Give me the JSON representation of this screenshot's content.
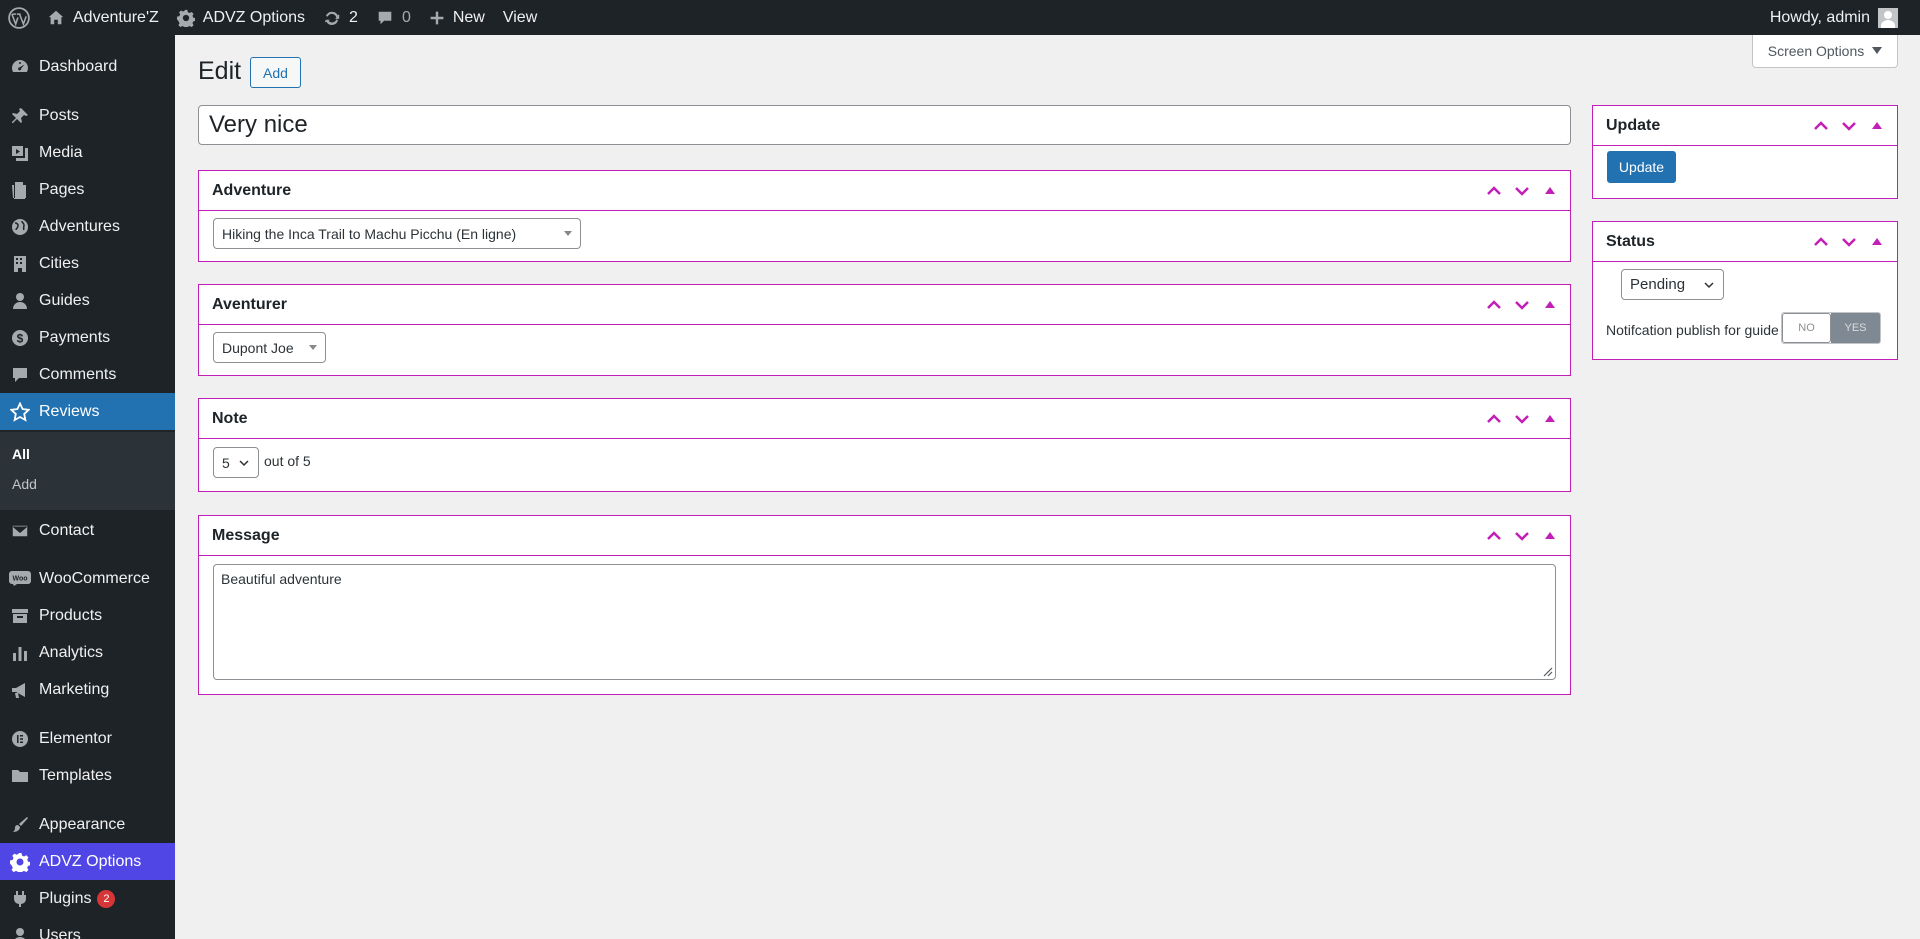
{
  "adminbar": {
    "site_name": "Adventure'Z",
    "options_label": "ADVZ Options",
    "updates_count": "2",
    "comments_count": "0",
    "new_label": "New",
    "view_label": "View",
    "howdy": "Howdy, admin"
  },
  "sidebar": {
    "dashboard": "Dashboard",
    "posts": "Posts",
    "media": "Media",
    "pages": "Pages",
    "adventures": "Adventures",
    "cities": "Cities",
    "guides": "Guides",
    "payments": "Payments",
    "comments": "Comments",
    "reviews": "Reviews",
    "sub_all": "All",
    "sub_add": "Add",
    "contact": "Contact",
    "woocommerce": "WooCommerce",
    "products": "Products",
    "analytics": "Analytics",
    "marketing": "Marketing",
    "elementor": "Elementor",
    "templates": "Templates",
    "appearance": "Appearance",
    "advz_options": "ADVZ Options",
    "plugins": "Plugins",
    "plugins_badge": "2",
    "users": "Users"
  },
  "screen_options": "Screen Options",
  "page": {
    "title": "Edit",
    "add_button": "Add",
    "post_title": "Very nice"
  },
  "boxes": {
    "adventure": {
      "title": "Adventure",
      "value": "Hiking the Inca Trail to Machu Picchu (En ligne)"
    },
    "aventurer": {
      "title": "Aventurer",
      "value": "Dupont Joe"
    },
    "note": {
      "title": "Note",
      "value": "5",
      "suffix": "out of 5"
    },
    "message": {
      "title": "Message",
      "value": "Beautiful adventure"
    },
    "update": {
      "title": "Update",
      "button": "Update"
    },
    "status": {
      "title": "Status",
      "value": "Pending",
      "notif_label": "Notifcation publish for guide",
      "toggle_no": "NO",
      "toggle_yes": "YES"
    }
  },
  "colors": {
    "accent": "#c21fb6",
    "primary": "#2271b1",
    "sidebar_bg": "#1d2327",
    "highlight": "#4f46e5"
  }
}
